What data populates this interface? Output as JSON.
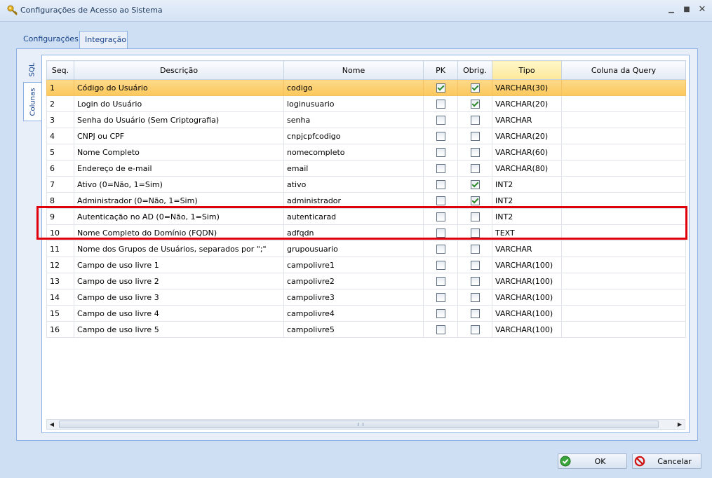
{
  "window": {
    "title": "Configurações de Acesso ao Sistema",
    "minimize_glyph": "▁",
    "maximize_glyph": "■",
    "close_glyph": "✕"
  },
  "outer_tabs": [
    "Configurações",
    "Integração"
  ],
  "side_tabs": [
    "SQL",
    "Colunas"
  ],
  "grid": {
    "columns": [
      "Seq.",
      "Descrição",
      "Nome",
      "PK",
      "Obrig.",
      "Tipo",
      "Coluna da Query"
    ],
    "rows": [
      {
        "seq": "1",
        "descricao": "Código do Usuário",
        "nome": "codigo",
        "pk": true,
        "obrig": true,
        "tipo": "VARCHAR(30)",
        "coluna": ""
      },
      {
        "seq": "2",
        "descricao": "Login do Usuário",
        "nome": "loginusuario",
        "pk": false,
        "obrig": true,
        "tipo": "VARCHAR(20)",
        "coluna": ""
      },
      {
        "seq": "3",
        "descricao": "Senha do Usuário (Sem Criptografia)",
        "nome": "senha",
        "pk": false,
        "obrig": false,
        "tipo": "VARCHAR",
        "coluna": ""
      },
      {
        "seq": "4",
        "descricao": "CNPJ ou CPF",
        "nome": "cnpjcpfcodigo",
        "pk": false,
        "obrig": false,
        "tipo": "VARCHAR(20)",
        "coluna": ""
      },
      {
        "seq": "5",
        "descricao": "Nome Completo",
        "nome": "nomecompleto",
        "pk": false,
        "obrig": false,
        "tipo": "VARCHAR(60)",
        "coluna": ""
      },
      {
        "seq": "6",
        "descricao": "Endereço de e-mail",
        "nome": "email",
        "pk": false,
        "obrig": false,
        "tipo": "VARCHAR(80)",
        "coluna": ""
      },
      {
        "seq": "7",
        "descricao": "Ativo (0=Não, 1=Sim)",
        "nome": "ativo",
        "pk": false,
        "obrig": true,
        "tipo": "INT2",
        "coluna": ""
      },
      {
        "seq": "8",
        "descricao": "Administrador (0=Não, 1=Sim)",
        "nome": "administrador",
        "pk": false,
        "obrig": true,
        "tipo": "INT2",
        "coluna": ""
      },
      {
        "seq": "9",
        "descricao": "Autenticação no AD (0=Não, 1=Sim)",
        "nome": "autenticarad",
        "pk": false,
        "obrig": false,
        "tipo": "INT2",
        "coluna": ""
      },
      {
        "seq": "10",
        "descricao": "Nome Completo do Domínio (FQDN)",
        "nome": "adfqdn",
        "pk": false,
        "obrig": false,
        "tipo": "TEXT",
        "coluna": ""
      },
      {
        "seq": "11",
        "descricao": "Nome dos Grupos de Usuários, separados por \";\"",
        "nome": "grupousuario",
        "pk": false,
        "obrig": false,
        "tipo": "VARCHAR",
        "coluna": ""
      },
      {
        "seq": "12",
        "descricao": "Campo de uso livre 1",
        "nome": "campolivre1",
        "pk": false,
        "obrig": false,
        "tipo": "VARCHAR(100)",
        "coluna": ""
      },
      {
        "seq": "13",
        "descricao": "Campo de uso livre 2",
        "nome": "campolivre2",
        "pk": false,
        "obrig": false,
        "tipo": "VARCHAR(100)",
        "coluna": ""
      },
      {
        "seq": "14",
        "descricao": "Campo de uso livre 3",
        "nome": "campolivre3",
        "pk": false,
        "obrig": false,
        "tipo": "VARCHAR(100)",
        "coluna": ""
      },
      {
        "seq": "15",
        "descricao": "Campo de uso livre 4",
        "nome": "campolivre4",
        "pk": false,
        "obrig": false,
        "tipo": "VARCHAR(100)",
        "coluna": ""
      },
      {
        "seq": "16",
        "descricao": "Campo de uso livre 5",
        "nome": "campolivre5",
        "pk": false,
        "obrig": false,
        "tipo": "VARCHAR(100)",
        "coluna": ""
      }
    ],
    "selected_row": 1,
    "highlighted_rows": [
      9,
      10
    ],
    "highlight_color": "#e0000b",
    "hscroll_left_glyph": "◀",
    "hscroll_right_glyph": "▶"
  },
  "buttons": {
    "ok_label": "OK",
    "cancel_label": "Cancelar"
  },
  "icons": {
    "title": "key-icon",
    "ok": "check-circle-icon",
    "cancel": "no-entry-icon"
  }
}
